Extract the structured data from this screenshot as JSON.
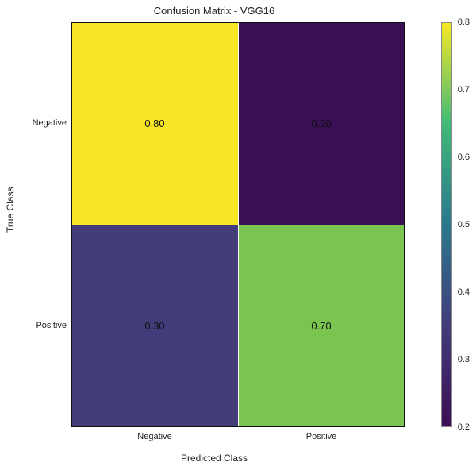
{
  "chart_data": {
    "type": "heatmap",
    "title": "Confusion Matrix - VGG16",
    "xlabel": "Predicted Class",
    "ylabel": "True Class",
    "row_labels": [
      "Negative",
      "Positive"
    ],
    "col_labels": [
      "Negative",
      "Positive"
    ],
    "values": [
      [
        0.8,
        0.2
      ],
      [
        0.3,
        0.7
      ]
    ],
    "value_labels": [
      [
        "0.80",
        "0.20"
      ],
      [
        "0.30",
        "0.70"
      ]
    ],
    "colormap": "viridis",
    "colorbar": {
      "min": 0.2,
      "max": 0.8,
      "ticks": [
        0.2,
        0.3,
        0.4,
        0.5,
        0.6,
        0.7,
        0.8
      ]
    }
  },
  "cell_colors": [
    [
      "#f7e726",
      "#3b0f55"
    ],
    [
      "#423c7a",
      "#7ac550"
    ]
  ]
}
